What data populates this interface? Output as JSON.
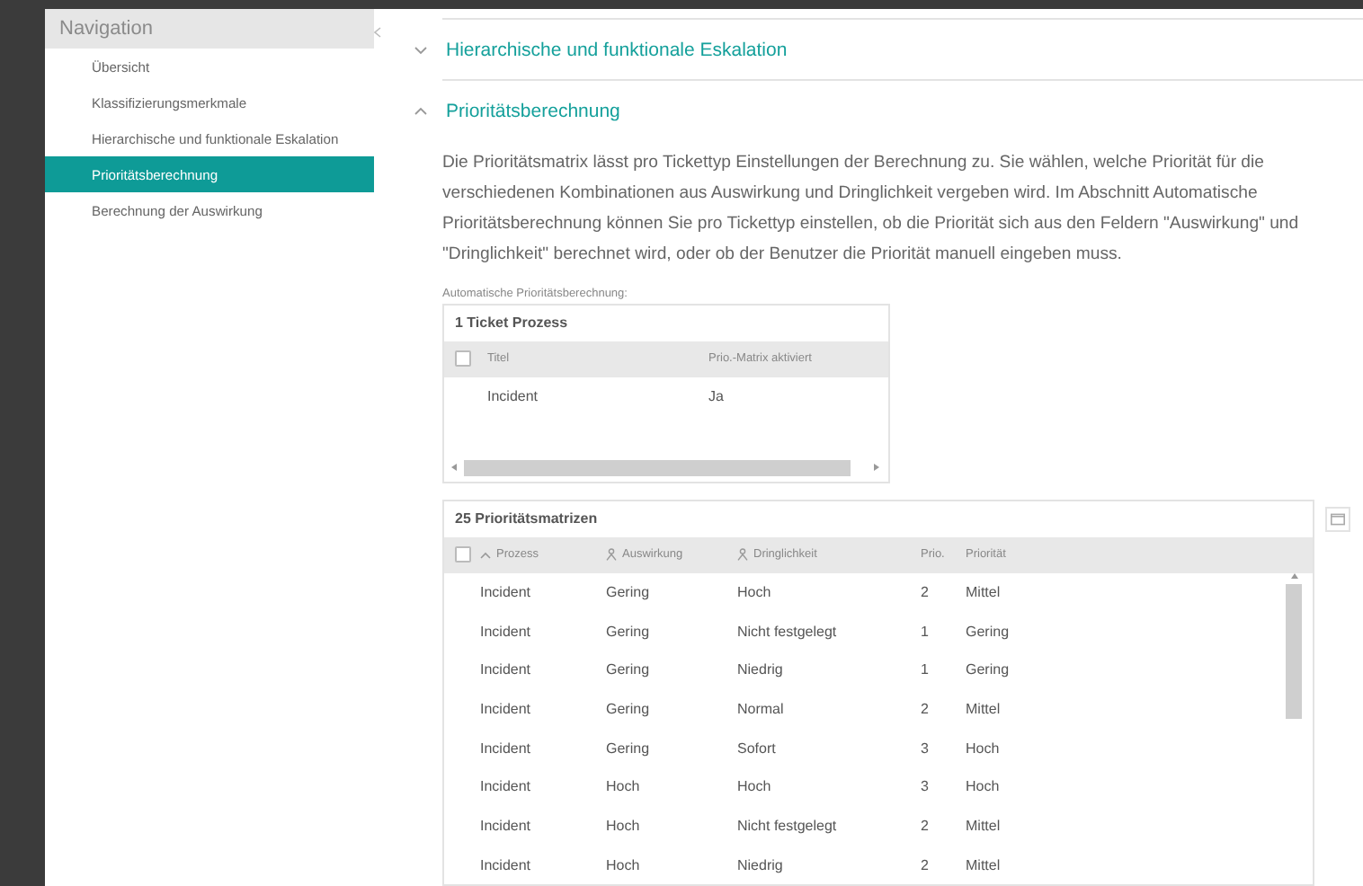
{
  "sidebar": {
    "title": "Navigation",
    "items": [
      {
        "label": "Übersicht",
        "selected": false
      },
      {
        "label": "Klassifizierungsmerkmale",
        "selected": false
      },
      {
        "label": "Hierarchische und funktionale Eskalation",
        "selected": false
      },
      {
        "label": "Prioritätsberechnung",
        "selected": true
      },
      {
        "label": "Berechnung der Auswirkung",
        "selected": false
      }
    ]
  },
  "sections": [
    {
      "title": "Hierarchische und funktionale Eskalation",
      "expanded": false
    },
    {
      "title": "Prioritätsberechnung",
      "expanded": true
    }
  ],
  "description": "Die Prioritätsmatrix lässt pro Tickettyp Einstellungen der Berechnung zu. Sie wählen, welche Priorität für die verschiedenen Kombinationen aus Auswirkung und Dringlichkeit vergeben wird. Im Abschnitt Automatische Prioritätsberechnung können Sie pro Tickettyp einstellen, ob die Priorität sich aus den Feldern \"Auswirkung\" und \"Dringlichkeit\" berechnet wird, oder ob der Benutzer die Priorität manuell eingeben muss.",
  "auto_label": "Automatische Prioritätsberechnung:",
  "process_table": {
    "title": "1 Ticket Prozess",
    "all_checked": false,
    "columns": [
      "Titel",
      "Prio.-Matrix aktiviert"
    ],
    "rows": [
      [
        "Incident",
        "Ja"
      ]
    ]
  },
  "matrix_table": {
    "title": "25 Prioritätsmatrizen",
    "all_checked": false,
    "columns": [
      {
        "label": "Prozess",
        "kind": "sorted"
      },
      {
        "label": "Auswirkung",
        "kind": "person"
      },
      {
        "label": "Dringlichkeit",
        "kind": "person"
      },
      {
        "label": "Prio.",
        "kind": "plain"
      },
      {
        "label": "Priorität",
        "kind": "plain"
      }
    ],
    "rows": [
      [
        "Incident",
        "Gering",
        "Hoch",
        "2",
        "Mittel"
      ],
      [
        "Incident",
        "Gering",
        "Nicht festgelegt",
        "1",
        "Gering"
      ],
      [
        "Incident",
        "Gering",
        "Niedrig",
        "1",
        "Gering"
      ],
      [
        "Incident",
        "Gering",
        "Normal",
        "2",
        "Mittel"
      ],
      [
        "Incident",
        "Gering",
        "Sofort",
        "3",
        "Hoch"
      ],
      [
        "Incident",
        "Hoch",
        "Hoch",
        "3",
        "Hoch"
      ],
      [
        "Incident",
        "Hoch",
        "Nicht festgelegt",
        "2",
        "Mittel"
      ],
      [
        "Incident",
        "Hoch",
        "Niedrig",
        "2",
        "Mittel"
      ]
    ]
  }
}
